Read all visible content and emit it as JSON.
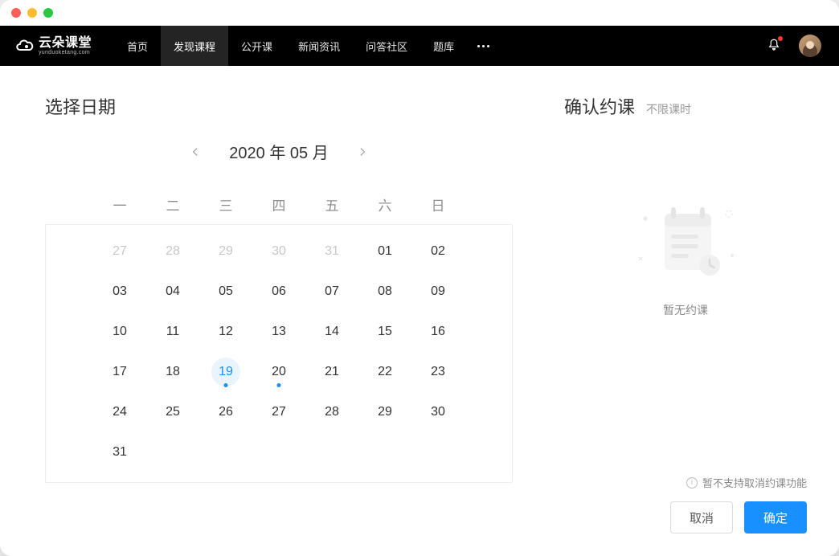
{
  "logo": {
    "text": "云朵课堂",
    "sub": "yunduoketang.com"
  },
  "nav": {
    "items": [
      {
        "label": "首页",
        "active": false
      },
      {
        "label": "发现课程",
        "active": true
      },
      {
        "label": "公开课",
        "active": false
      },
      {
        "label": "新闻资讯",
        "active": false
      },
      {
        "label": "问答社区",
        "active": false
      },
      {
        "label": "题库",
        "active": false
      }
    ]
  },
  "calendar": {
    "title": "选择日期",
    "month_label": "2020 年 05 月",
    "weekdays": [
      "一",
      "二",
      "三",
      "四",
      "五",
      "六",
      "日"
    ],
    "cells": [
      {
        "d": "27",
        "dim": true
      },
      {
        "d": "28",
        "dim": true
      },
      {
        "d": "29",
        "dim": true
      },
      {
        "d": "30",
        "dim": true
      },
      {
        "d": "31",
        "dim": true
      },
      {
        "d": "01"
      },
      {
        "d": "02"
      },
      {
        "d": "03"
      },
      {
        "d": "04"
      },
      {
        "d": "05"
      },
      {
        "d": "06"
      },
      {
        "d": "07"
      },
      {
        "d": "08"
      },
      {
        "d": "09"
      },
      {
        "d": "10"
      },
      {
        "d": "11"
      },
      {
        "d": "12"
      },
      {
        "d": "13"
      },
      {
        "d": "14"
      },
      {
        "d": "15"
      },
      {
        "d": "16"
      },
      {
        "d": "17"
      },
      {
        "d": "18"
      },
      {
        "d": "19",
        "today": true,
        "dot": true
      },
      {
        "d": "20",
        "dot": true
      },
      {
        "d": "21"
      },
      {
        "d": "22"
      },
      {
        "d": "23"
      },
      {
        "d": "24"
      },
      {
        "d": "25"
      },
      {
        "d": "26"
      },
      {
        "d": "27"
      },
      {
        "d": "28"
      },
      {
        "d": "29"
      },
      {
        "d": "30"
      },
      {
        "d": "31"
      }
    ]
  },
  "booking": {
    "title": "确认约课",
    "subtitle": "不限课时",
    "empty_text": "暂无约课",
    "notice": "暂不支持取消约课功能",
    "info_glyph": "i",
    "cancel_label": "取消",
    "confirm_label": "确定"
  },
  "colors": {
    "accent": "#1890ff"
  }
}
